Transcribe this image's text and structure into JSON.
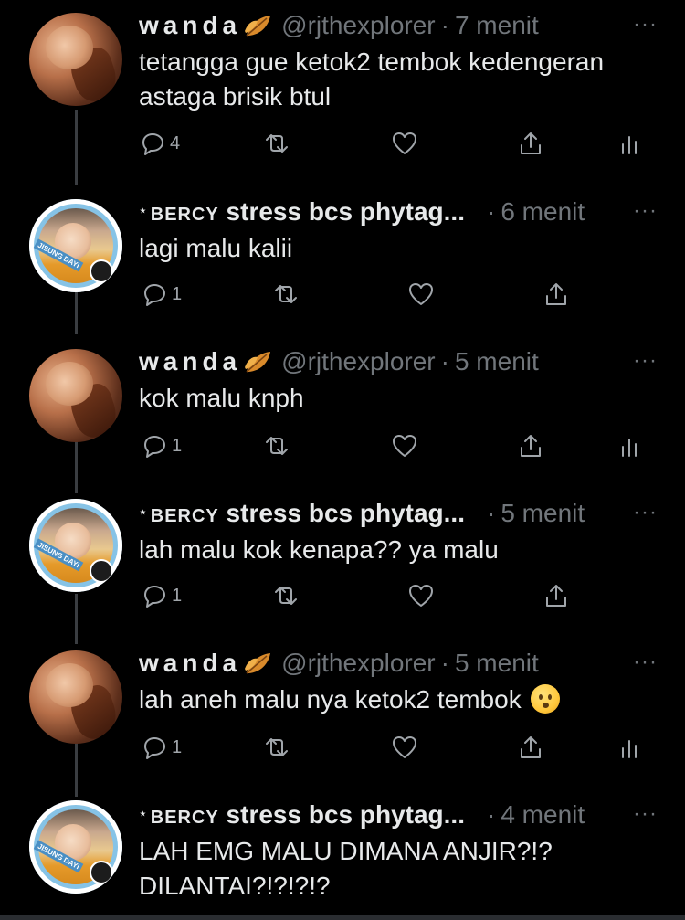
{
  "colors": {
    "background": "#000000",
    "text_primary": "#e7e9ea",
    "text_secondary": "#71767b",
    "icon": "#a0a5aa",
    "thread_line": "#3a3d41"
  },
  "tweets": [
    {
      "author": "wanda",
      "handle": "@rjthexplorer",
      "separator": "·",
      "time": "7 menit",
      "more": "···",
      "text": "tetangga gue ketok2 tembok kedengeran\nastaga brisik btul",
      "reply_count": "4",
      "name_icon": "leaf-icon",
      "avatar": "avatar-wanda"
    },
    {
      "author_star": "⋆",
      "author_caps": "BERCY",
      "author_rest": " stress bcs phytag...",
      "separator": "·",
      "time": "6 menit",
      "more": "···",
      "text": "lagi malu kalii",
      "reply_count": "1",
      "avatar": "avatar-bercy"
    },
    {
      "author": "wanda",
      "handle": "@rjthexplorer",
      "separator": "·",
      "time": "5 menit",
      "more": "···",
      "text": "kok malu knph",
      "reply_count": "1",
      "name_icon": "leaf-icon",
      "avatar": "avatar-wanda"
    },
    {
      "author_star": "⋆",
      "author_caps": "BERCY",
      "author_rest": " stress bcs phytag...",
      "separator": "·",
      "time": "5 menit",
      "more": "···",
      "text": "lah malu kok kenapa?? ya malu",
      "reply_count": "1",
      "avatar": "avatar-bercy"
    },
    {
      "author": "wanda",
      "handle": "@rjthexplorer",
      "separator": "·",
      "time": "5 menit",
      "more": "···",
      "text": "lah aneh malu nya ketok2 tembok",
      "text_emoji": "frowning-face-emoji",
      "reply_count": "1",
      "name_icon": "leaf-icon",
      "avatar": "avatar-wanda"
    },
    {
      "author_star": "⋆",
      "author_caps": "BERCY",
      "author_rest": " stress bcs phytag...",
      "separator": "·",
      "time": "4 menit",
      "more": "···",
      "text": "LAH EMG MALU DIMANA ANJIR?!?\nDILANTAI?!?!?!?",
      "avatar": "avatar-bercy"
    }
  ],
  "avatar_labels": {
    "bercy_tag": "JISUNG DAYI"
  }
}
